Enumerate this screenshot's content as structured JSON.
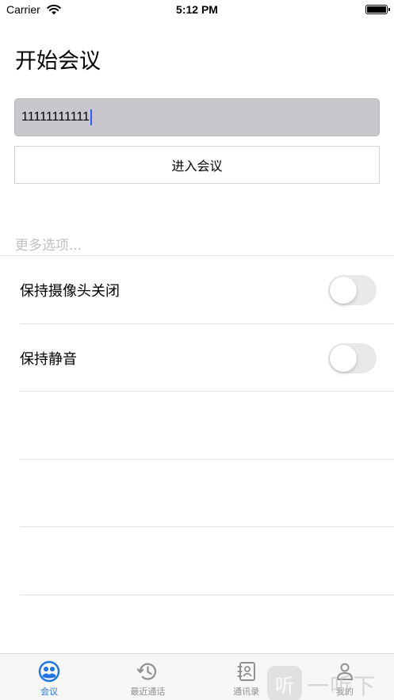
{
  "status_bar": {
    "carrier": "Carrier",
    "time": "5:12 PM",
    "battery_level": 1.0
  },
  "page": {
    "title": "开始会议"
  },
  "meeting_input": {
    "value": "11111111111"
  },
  "join_button": {
    "label": "进入会议"
  },
  "more_options": {
    "label": "更多选项..."
  },
  "settings": [
    {
      "label": "保持摄像头关闭",
      "on": false
    },
    {
      "label": "保持静音",
      "on": false
    }
  ],
  "tab_bar": {
    "tabs": [
      {
        "label": "会议",
        "icon": "meeting-icon",
        "active": true
      },
      {
        "label": "最近通话",
        "icon": "history-icon",
        "active": false
      },
      {
        "label": "通讯录",
        "icon": "contacts-icon",
        "active": false
      },
      {
        "label": "我的",
        "icon": "profile-icon",
        "active": false
      }
    ]
  },
  "colors": {
    "accent": "#1e73e8",
    "input_bg": "#c7c7cc",
    "toggle_off": "#e9e9ea"
  },
  "watermark": {
    "badge": "听",
    "text": "一听下载"
  }
}
